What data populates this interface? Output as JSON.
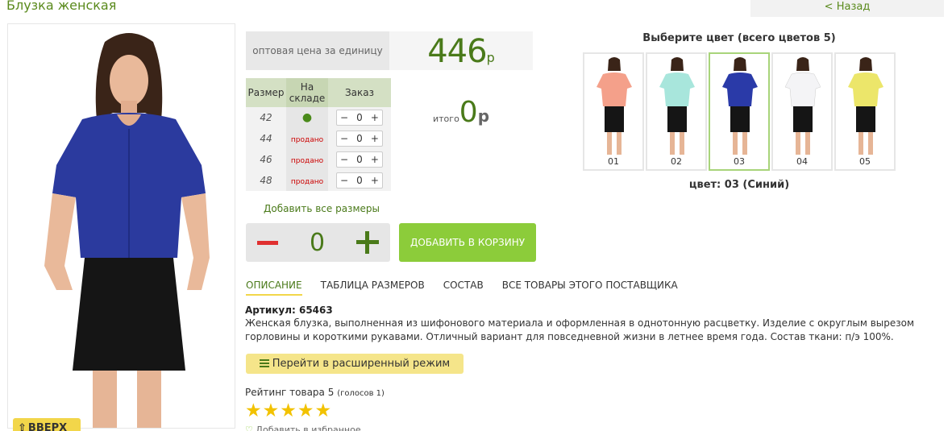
{
  "header": {
    "title": "Блузка женская",
    "back_label": "< Назад"
  },
  "up_button": {
    "label": "ВВЕРХ"
  },
  "price": {
    "label": "оптовая цена за единицу",
    "value": "446",
    "currency": "р"
  },
  "size_table": {
    "headers": [
      "Размер",
      "На складе",
      "Заказ"
    ],
    "rows": [
      {
        "size": "42",
        "stock": "●",
        "qty": "0"
      },
      {
        "size": "44",
        "stock": "продано",
        "qty": "0"
      },
      {
        "size": "46",
        "stock": "продано",
        "qty": "0"
      },
      {
        "size": "48",
        "stock": "продано",
        "qty": "0"
      }
    ]
  },
  "total": {
    "label": "итого",
    "value": "0",
    "currency": "р"
  },
  "add_all_sizes": "Добавить все размеры",
  "quantity": {
    "value": "0"
  },
  "cart_button": "ДОБАВИТЬ В КОРЗИНУ",
  "tabs": [
    "ОПИСАНИЕ",
    "ТАБЛИЦА РАЗМЕРОВ",
    "СОСТАВ",
    "ВСЕ ТОВАРЫ ЭТОГО ПОСТАВЩИКА"
  ],
  "article": "Артикул: 65463",
  "description": "Женская блузка, выполненная из шифонового материала и оформленная в однотонную расцветку. Изделие с округлым вырезом горловины и короткими рукавами. Отличный вариант для повседневной жизни в летнее время года. Состав ткани: п/э 100%.",
  "extended_mode_button": "Перейти в расширенный режим",
  "rating": {
    "label": "Рейтинг товара 5",
    "votes": "(голосов 1)",
    "stars": 5
  },
  "favorites_label": "Добавить в избранное",
  "colors": {
    "title": "Выберите цвет (всего цветов 5)",
    "swatches": [
      {
        "num": "01",
        "color": "#f4a08a"
      },
      {
        "num": "02",
        "color": "#a8e6dc"
      },
      {
        "num": "03",
        "color": "#2a3aa8"
      },
      {
        "num": "04",
        "color": "#f4f4f6"
      },
      {
        "num": "05",
        "color": "#ece66a"
      }
    ],
    "selected_label": "цвет: 03 (Синий)"
  }
}
